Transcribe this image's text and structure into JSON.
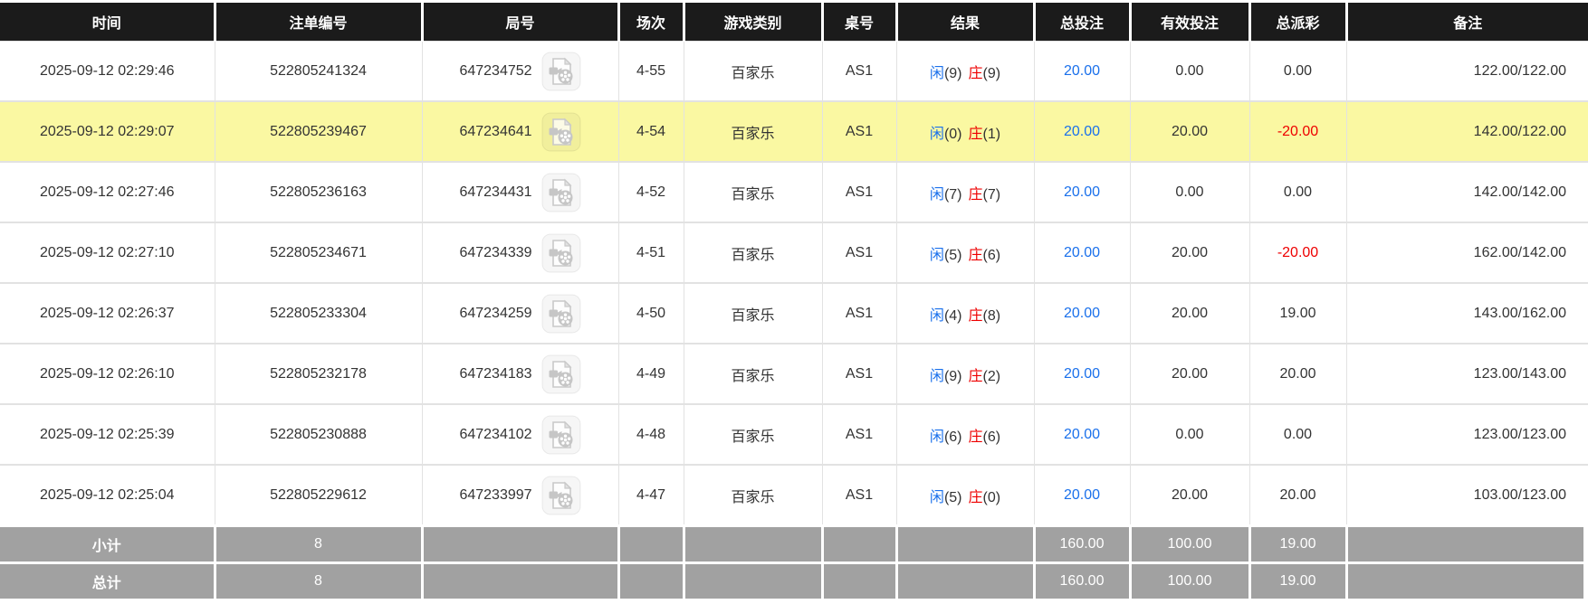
{
  "table": {
    "columns": [
      {
        "key": "time",
        "label": "时间"
      },
      {
        "key": "bet_id",
        "label": "注单编号"
      },
      {
        "key": "round",
        "label": "局号"
      },
      {
        "key": "session",
        "label": "场次"
      },
      {
        "key": "game_type",
        "label": "游戏类别"
      },
      {
        "key": "table_no",
        "label": "桌号"
      },
      {
        "key": "result",
        "label": "结果"
      },
      {
        "key": "total_bet",
        "label": "总投注"
      },
      {
        "key": "valid_bet",
        "label": "有效投注"
      },
      {
        "key": "payout",
        "label": "总派彩"
      },
      {
        "key": "remark",
        "label": "备注"
      }
    ],
    "result_labels": {
      "player": "闲",
      "banker": "庄"
    },
    "icons": {
      "round_icon": "video-replay-icon"
    },
    "rows": [
      {
        "time": "2025-09-12 02:29:46",
        "bet_id": "522805241324",
        "round": "647234752",
        "session": "4-55",
        "game_type": "百家乐",
        "table_no": "AS1",
        "player_score": "(9)",
        "banker_score": "(9)",
        "total_bet": "20.00",
        "valid_bet": "0.00",
        "payout": "0.00",
        "remark": "122.00/122.00",
        "highlighted": false
      },
      {
        "time": "2025-09-12 02:29:07",
        "bet_id": "522805239467",
        "round": "647234641",
        "session": "4-54",
        "game_type": "百家乐",
        "table_no": "AS1",
        "player_score": "(0)",
        "banker_score": "(1)",
        "total_bet": "20.00",
        "valid_bet": "20.00",
        "payout": "-20.00",
        "remark": "142.00/122.00",
        "highlighted": true
      },
      {
        "time": "2025-09-12 02:27:46",
        "bet_id": "522805236163",
        "round": "647234431",
        "session": "4-52",
        "game_type": "百家乐",
        "table_no": "AS1",
        "player_score": "(7)",
        "banker_score": "(7)",
        "total_bet": "20.00",
        "valid_bet": "0.00",
        "payout": "0.00",
        "remark": "142.00/142.00",
        "highlighted": false
      },
      {
        "time": "2025-09-12 02:27:10",
        "bet_id": "522805234671",
        "round": "647234339",
        "session": "4-51",
        "game_type": "百家乐",
        "table_no": "AS1",
        "player_score": "(5)",
        "banker_score": "(6)",
        "total_bet": "20.00",
        "valid_bet": "20.00",
        "payout": "-20.00",
        "remark": "162.00/142.00",
        "highlighted": false
      },
      {
        "time": "2025-09-12 02:26:37",
        "bet_id": "522805233304",
        "round": "647234259",
        "session": "4-50",
        "game_type": "百家乐",
        "table_no": "AS1",
        "player_score": "(4)",
        "banker_score": "(8)",
        "total_bet": "20.00",
        "valid_bet": "20.00",
        "payout": "19.00",
        "remark": "143.00/162.00",
        "highlighted": false
      },
      {
        "time": "2025-09-12 02:26:10",
        "bet_id": "522805232178",
        "round": "647234183",
        "session": "4-49",
        "game_type": "百家乐",
        "table_no": "AS1",
        "player_score": "(9)",
        "banker_score": "(2)",
        "total_bet": "20.00",
        "valid_bet": "20.00",
        "payout": "20.00",
        "remark": "123.00/143.00",
        "highlighted": false
      },
      {
        "time": "2025-09-12 02:25:39",
        "bet_id": "522805230888",
        "round": "647234102",
        "session": "4-48",
        "game_type": "百家乐",
        "table_no": "AS1",
        "player_score": "(6)",
        "banker_score": "(6)",
        "total_bet": "20.00",
        "valid_bet": "0.00",
        "payout": "0.00",
        "remark": "123.00/123.00",
        "highlighted": false
      },
      {
        "time": "2025-09-12 02:25:04",
        "bet_id": "522805229612",
        "round": "647233997",
        "session": "4-47",
        "game_type": "百家乐",
        "table_no": "AS1",
        "player_score": "(5)",
        "banker_score": "(0)",
        "total_bet": "20.00",
        "valid_bet": "20.00",
        "payout": "20.00",
        "remark": "103.00/123.00",
        "highlighted": false
      }
    ],
    "summary_rows": [
      {
        "label": "小计",
        "count": "8",
        "total_bet": "160.00",
        "valid_bet": "100.00",
        "payout": "19.00"
      },
      {
        "label": "总计",
        "count": "8",
        "total_bet": "160.00",
        "valid_bet": "100.00",
        "payout": "19.00"
      }
    ],
    "colors": {
      "header_bg": "#1b1b1b",
      "highlight_row": "#faf8a2",
      "summary_bg": "#a1a1a1",
      "link_blue": "#1a70eb",
      "negative_red": "#ee0000",
      "player_blue": "#1a70eb",
      "banker_red": "#ee0000",
      "body_text": "#333333",
      "border": "#e2e2e2"
    }
  }
}
